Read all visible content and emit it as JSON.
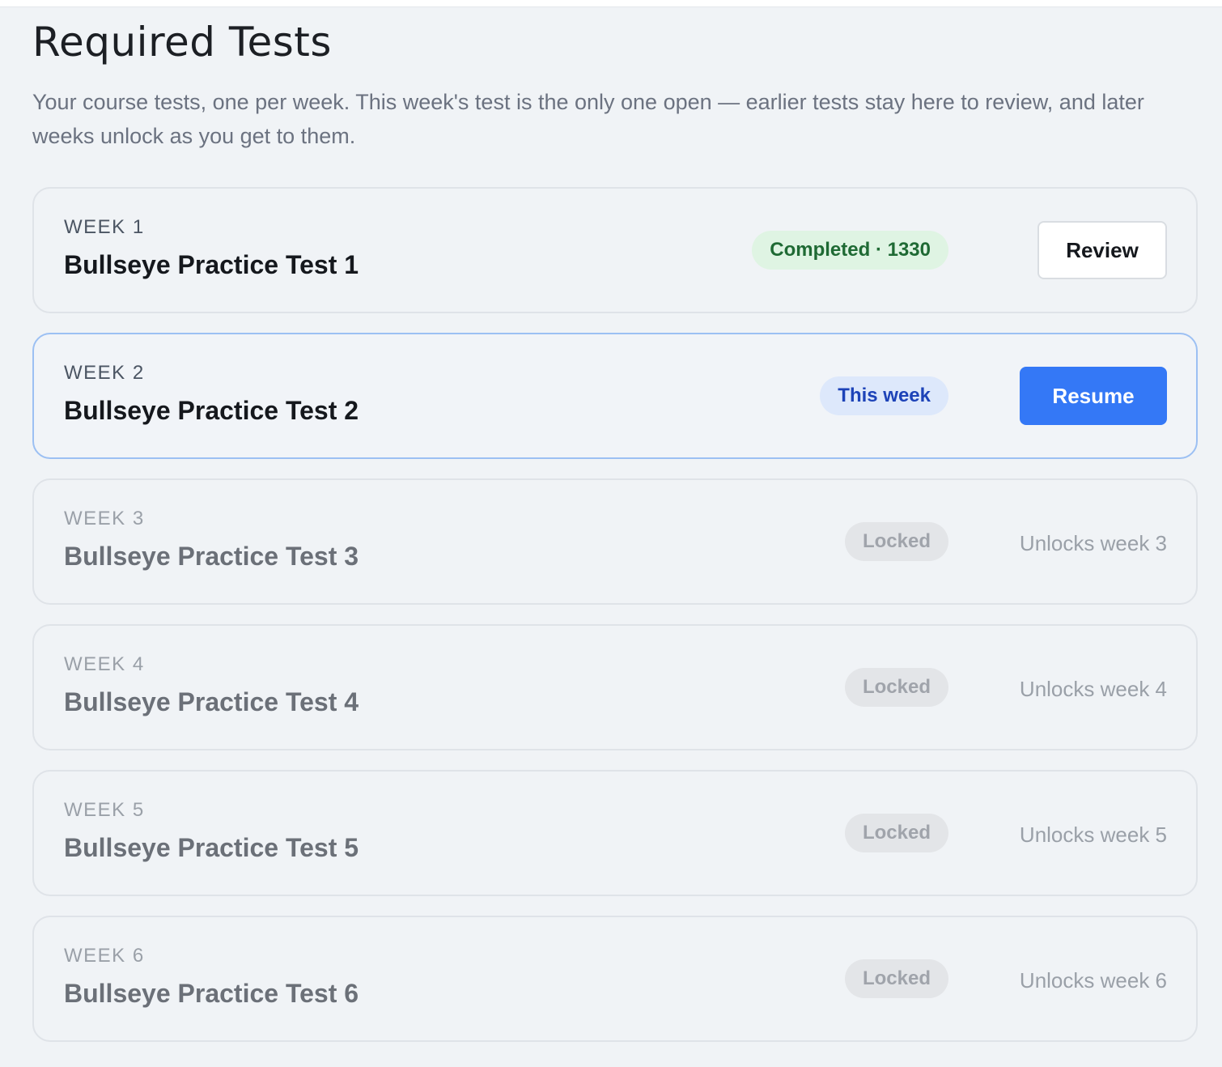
{
  "header": {
    "title": "Required Tests",
    "description": "Your course tests, one per week. This week's test is the only one open — earlier tests stay here to review, and later weeks unlock as you get to them."
  },
  "tests": [
    {
      "week_label": "WEEK 1",
      "name": "Bullseye Practice Test 1",
      "status": "completed",
      "badge": "Completed · 1330",
      "action_label": "Review"
    },
    {
      "week_label": "WEEK 2",
      "name": "Bullseye Practice Test 2",
      "status": "current",
      "badge": "This week",
      "action_label": "Resume"
    },
    {
      "week_label": "WEEK 3",
      "name": "Bullseye Practice Test 3",
      "status": "locked",
      "badge": "Locked",
      "unlock_note": "Unlocks week 3"
    },
    {
      "week_label": "WEEK 4",
      "name": "Bullseye Practice Test 4",
      "status": "locked",
      "badge": "Locked",
      "unlock_note": "Unlocks week 4"
    },
    {
      "week_label": "WEEK 5",
      "name": "Bullseye Practice Test 5",
      "status": "locked",
      "badge": "Locked",
      "unlock_note": "Unlocks week 5"
    },
    {
      "week_label": "WEEK 6",
      "name": "Bullseye Practice Test 6",
      "status": "locked",
      "badge": "Locked",
      "unlock_note": "Unlocks week 6"
    }
  ],
  "colors": {
    "page_background": "#f0f3f6",
    "primary_button": "#3478f6",
    "completed_badge_bg": "#dff4e3",
    "completed_badge_text": "#1f6a34",
    "this_week_badge_bg": "#dde8fb",
    "this_week_badge_text": "#1d43b8",
    "current_card_border": "#9cc0f3",
    "locked_badge_bg": "#e3e5e8"
  }
}
